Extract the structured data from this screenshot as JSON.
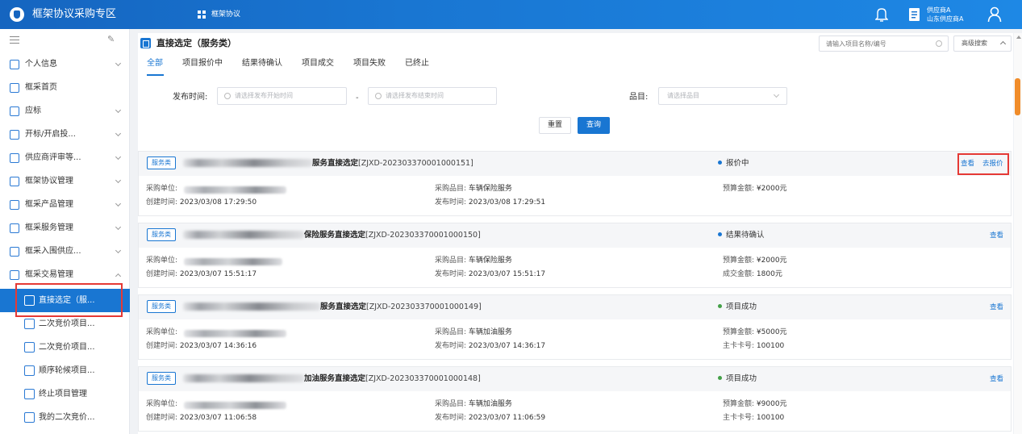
{
  "header": {
    "app_title": "框架协议采购专区",
    "nav_label": "框架协议",
    "user_line1": "供应商A",
    "user_line2": "山东供应商A",
    "icons": [
      "shield-logo-icon",
      "grid-icon",
      "bell-icon",
      "document-icon",
      "user-icon"
    ]
  },
  "sidebar": {
    "menu_items": [
      {
        "label": "个人信息",
        "has_chevron": true
      },
      {
        "label": "框采首页",
        "has_chevron": false
      },
      {
        "label": "应标",
        "has_chevron": true
      },
      {
        "label": "开标/开启投...",
        "has_chevron": true
      },
      {
        "label": "供应商评审等...",
        "has_chevron": true
      },
      {
        "label": "框架协议管理",
        "has_chevron": true
      },
      {
        "label": "框采产品管理",
        "has_chevron": true
      },
      {
        "label": "框采服务管理",
        "has_chevron": true
      },
      {
        "label": "框采入围供应...",
        "has_chevron": true
      },
      {
        "label": "框采交易管理",
        "has_chevron": true,
        "expanded": true
      }
    ],
    "sub_items": [
      {
        "label": "直接选定（服...",
        "active": true
      },
      {
        "label": "二次竞价项目..."
      },
      {
        "label": "二次竞价项目..."
      },
      {
        "label": "顺序轮候项目..."
      },
      {
        "label": "终止项目管理"
      },
      {
        "label": "我的二次竞价..."
      }
    ]
  },
  "page": {
    "title": "直接选定（服务类）",
    "search_placeholder": "请输入项目名称/编号",
    "advanced_search": "高级搜索",
    "tabs": [
      "全部",
      "项目报价中",
      "结果待确认",
      "项目成交",
      "项目失败",
      "已终止"
    ],
    "active_tab": 0
  },
  "filters": {
    "publish_time_label": "发布时间:",
    "start_placeholder": "请选择发布开始时间",
    "separator": "-",
    "end_placeholder": "请选择发布结束时间",
    "category_label": "品目:",
    "category_placeholder": "请选择品目",
    "reset_label": "重置",
    "query_label": "查询"
  },
  "labels": {
    "buyer": "采购单位:",
    "created": "创建时间:",
    "category": "采购品目:",
    "published": "发布时间:",
    "budget": "预算金额:",
    "deal_amount": "成交金额:",
    "card_no": "主卡卡号:",
    "view": "查看",
    "quote": "去报价"
  },
  "colors": {
    "primary": "#1976d2",
    "status_blue": "#1976d2",
    "status_green": "#43a047",
    "highlight_red": "#e53935",
    "scroll_thumb": "#f08c2a"
  },
  "records": [
    {
      "tag": "服务类",
      "title_suffix": "服务直接选定",
      "code": "[ZJXD-202303370001000151]",
      "status": "报价中",
      "status_color": "#1976d2",
      "actions": [
        "查看",
        "去报价"
      ],
      "created_time": "2023/03/08 17:29:50",
      "category": "车辆保险服务",
      "publish_time": "2023/03/08 17:29:51",
      "extra1_label": "预算金额:",
      "extra1_value": "¥2000元",
      "extra2_label": "",
      "extra2_value": ""
    },
    {
      "tag": "服务类",
      "title_suffix": "保险服务直接选定",
      "code": "[ZJXD-202303370001000150]",
      "status": "结果待确认",
      "status_color": "#1976d2",
      "actions": [
        "查看"
      ],
      "created_time": "2023/03/07 15:51:17",
      "category": "车辆保险服务",
      "publish_time": "2023/03/07 15:51:17",
      "extra1_label": "预算金额:",
      "extra1_value": "¥2000元",
      "extra2_label": "成交金额:",
      "extra2_value": "1800元"
    },
    {
      "tag": "服务类",
      "title_suffix": "服务直接选定",
      "code": "[ZJXD-202303370001000149]",
      "status": "项目成功",
      "status_color": "#43a047",
      "actions": [
        "查看"
      ],
      "created_time": "2023/03/07 14:36:16",
      "category": "车辆加油服务",
      "publish_time": "2023/03/07 14:36:17",
      "extra1_label": "预算金额:",
      "extra1_value": "¥5000元",
      "extra2_label": "主卡卡号:",
      "extra2_value": "100100"
    },
    {
      "tag": "服务类",
      "title_suffix": "加油服务直接选定",
      "code": "[ZJXD-202303370001000148]",
      "status": "项目成功",
      "status_color": "#43a047",
      "actions": [
        "查看"
      ],
      "created_time": "2023/03/07 11:06:58",
      "category": "车辆加油服务",
      "publish_time": "2023/03/07 11:06:59",
      "extra1_label": "预算金额:",
      "extra1_value": "¥9000元",
      "extra2_label": "主卡卡号:",
      "extra2_value": "100100"
    }
  ]
}
